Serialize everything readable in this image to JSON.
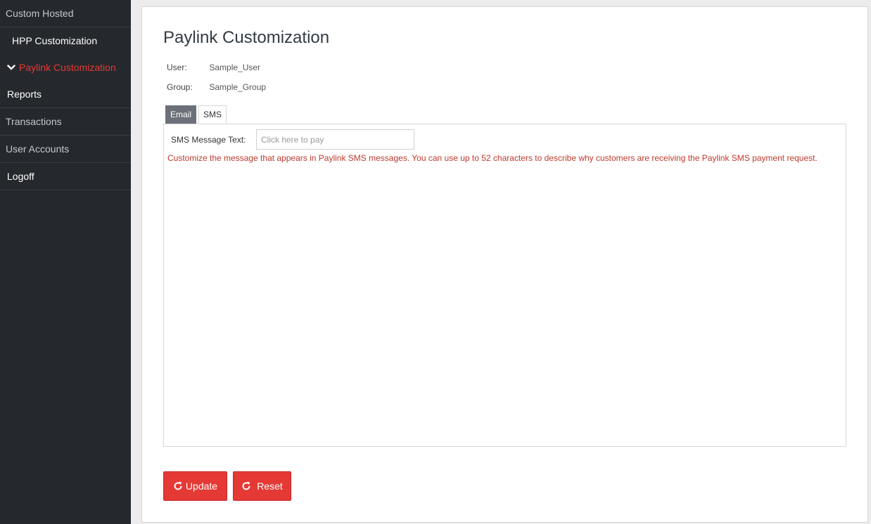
{
  "sidebar": {
    "items": [
      {
        "label": "Custom Hosted"
      },
      {
        "label": "HPP Customization"
      },
      {
        "label": "Paylink Customization"
      },
      {
        "label": "Reports"
      },
      {
        "label": "Transactions"
      },
      {
        "label": "User Accounts"
      },
      {
        "label": "Logoff"
      }
    ],
    "active_icon": "chevron-down-icon"
  },
  "main": {
    "title": "Paylink Customization",
    "user_label": "User:",
    "user_value": "Sample_User",
    "group_label": "Group:",
    "group_value": "Sample_Group",
    "tabs": [
      {
        "label": "Email"
      },
      {
        "label": "SMS"
      }
    ],
    "active_tab": "SMS",
    "sms": {
      "field_label": "SMS Message Text:",
      "placeholder": "Click here to pay",
      "value": "",
      "help_text": "Customize the message that appears in Paylink SMS messages. You can use up to 52 characters to describe why customers are receiving the Paylink SMS payment request."
    }
  },
  "actions": {
    "update_label": "Update",
    "reset_label": "Reset",
    "icon": "refresh-icon"
  },
  "colors": {
    "accent": "#e53935",
    "sidebar_bg": "#25282c",
    "help_text": "#c0392b"
  }
}
